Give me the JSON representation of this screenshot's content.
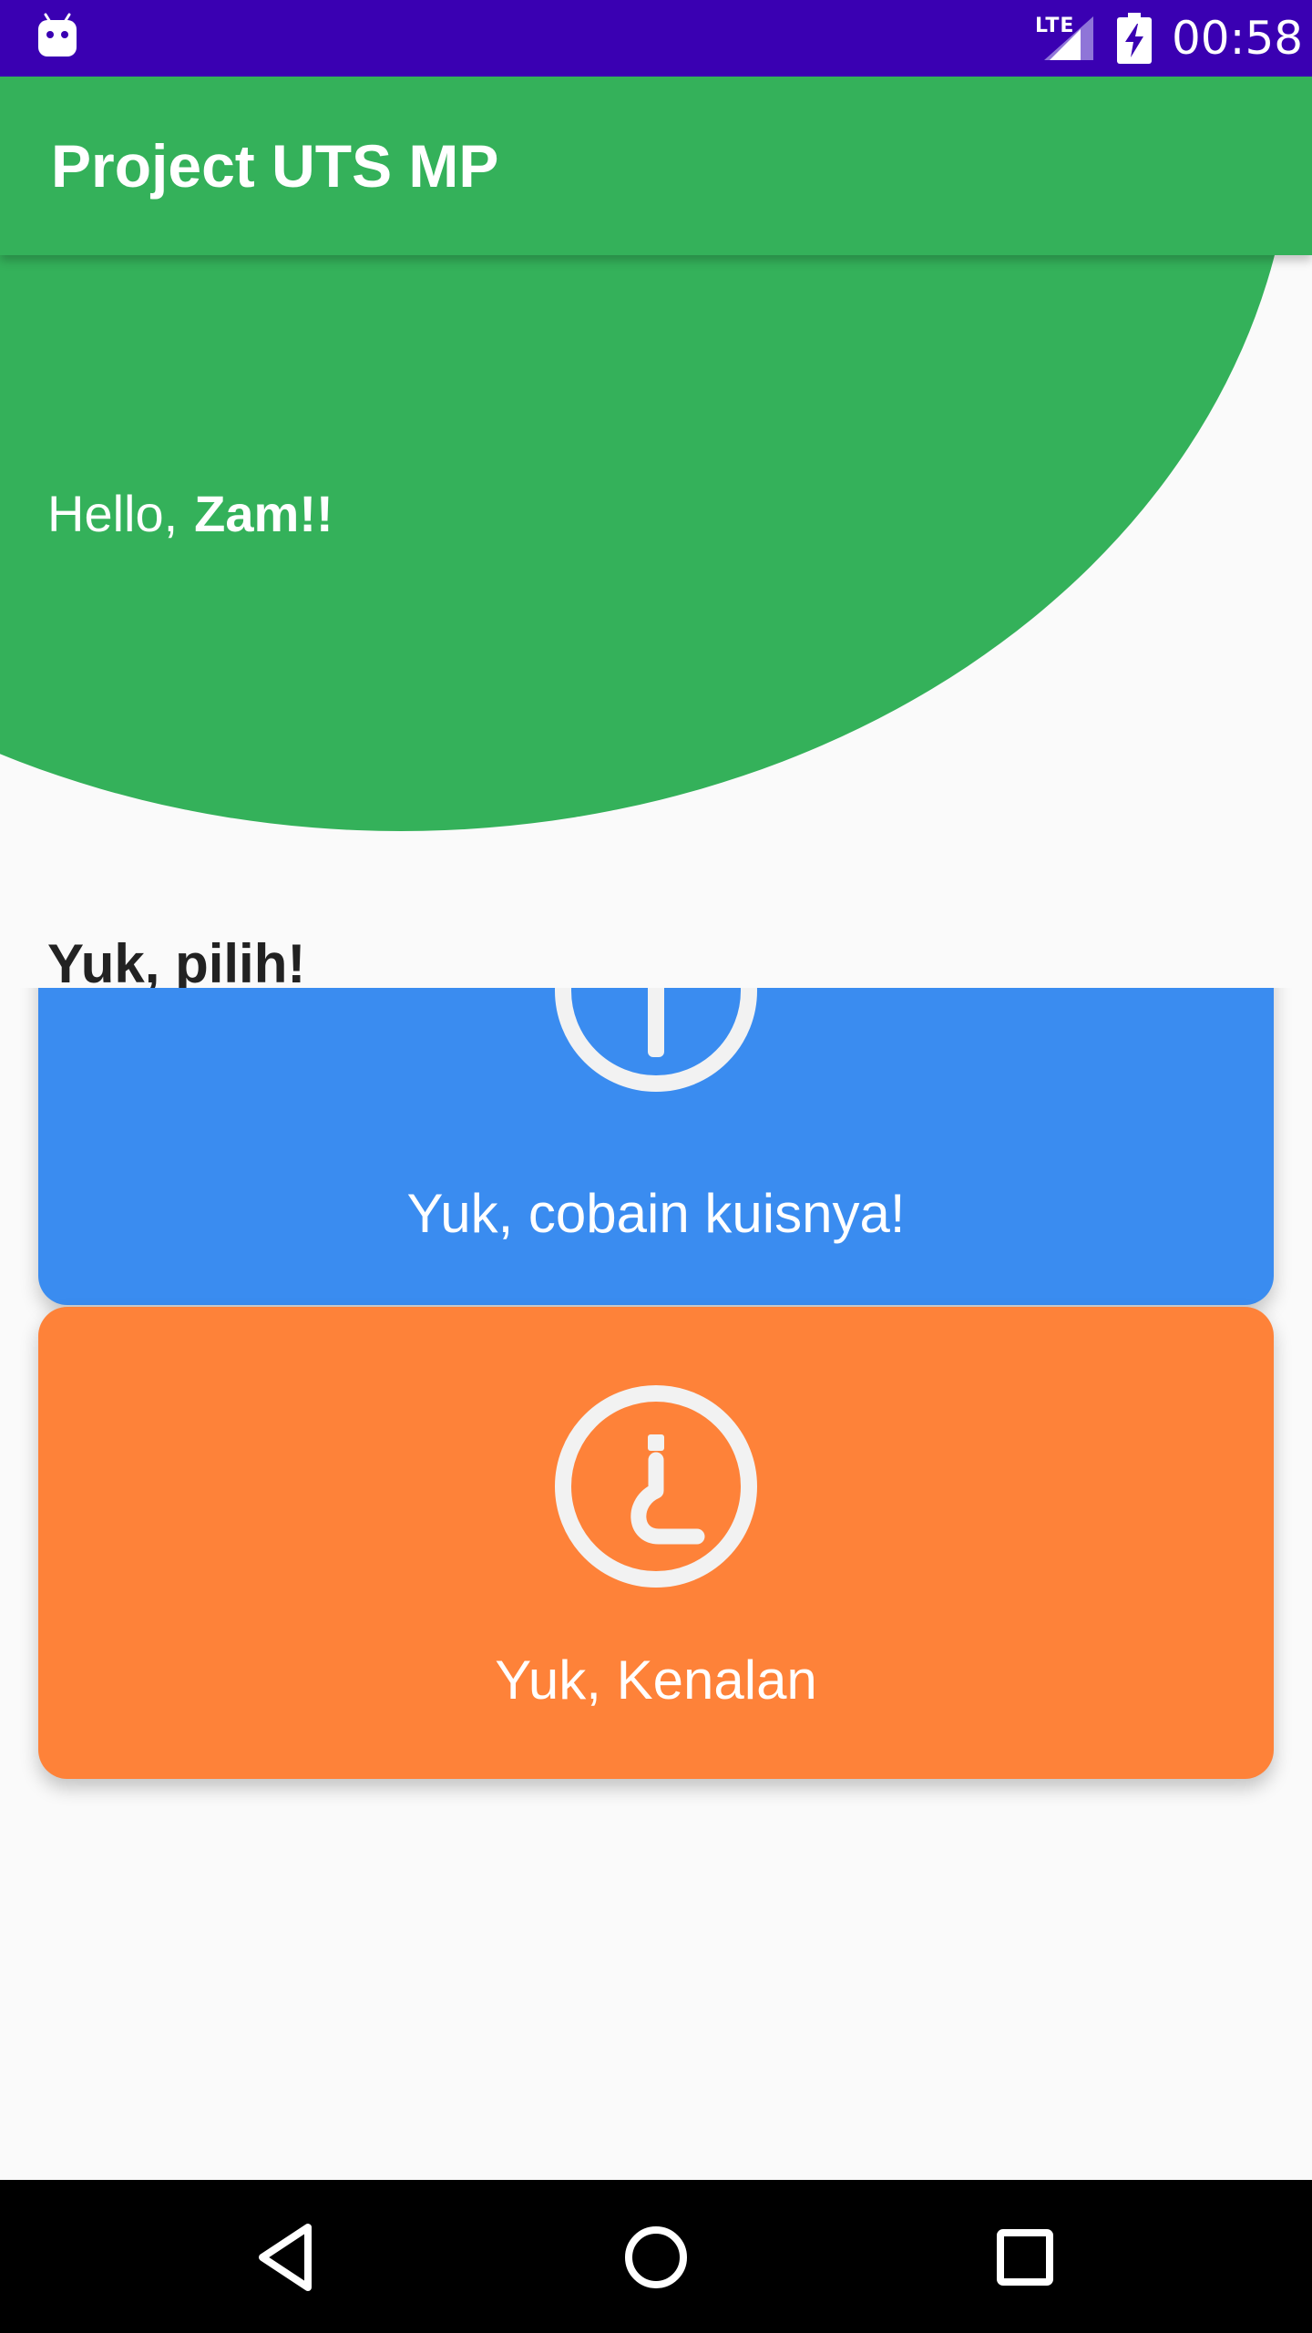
{
  "status_bar": {
    "network_label": "LTE",
    "time": "00:58",
    "icons": [
      "android-icon",
      "signal-icon",
      "battery-charging-icon"
    ]
  },
  "app_bar": {
    "title": "Project UTS MP"
  },
  "greeting": {
    "prefix": "Hello,",
    "name": "Zam!!"
  },
  "section_title": "Yuk, pilih!",
  "cards": [
    {
      "label": "Yuk, cobain kuisnya!",
      "icon": "quiz-icon",
      "color": "#3a8cf0"
    },
    {
      "label": "Yuk, Kenalan",
      "icon": "question-icon",
      "color": "#fe8239"
    }
  ],
  "nav_bar": {
    "icons": [
      "back-icon",
      "home-icon",
      "recents-icon"
    ]
  },
  "colors": {
    "status_bar": "#3a00b2",
    "primary": "#34b15a",
    "background": "#fafafa",
    "nav_bar": "#000000"
  }
}
